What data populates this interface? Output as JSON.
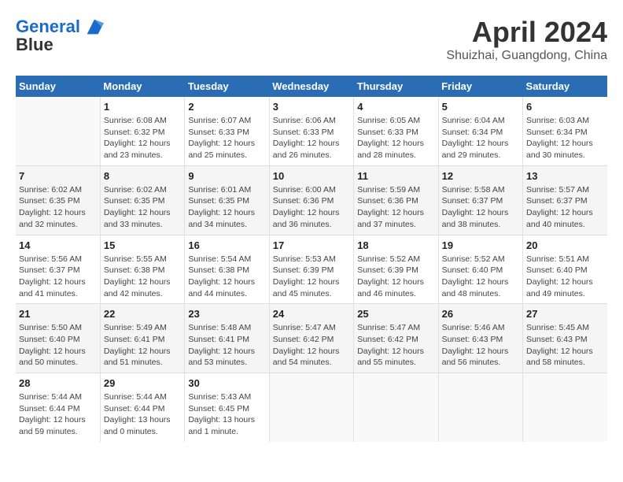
{
  "header": {
    "logo_line1": "General",
    "logo_line2": "Blue",
    "month": "April 2024",
    "location": "Shuizhai, Guangdong, China"
  },
  "weekdays": [
    "Sunday",
    "Monday",
    "Tuesday",
    "Wednesday",
    "Thursday",
    "Friday",
    "Saturday"
  ],
  "weeks": [
    [
      {
        "day": "",
        "info": ""
      },
      {
        "day": "1",
        "info": "Sunrise: 6:08 AM\nSunset: 6:32 PM\nDaylight: 12 hours\nand 23 minutes."
      },
      {
        "day": "2",
        "info": "Sunrise: 6:07 AM\nSunset: 6:33 PM\nDaylight: 12 hours\nand 25 minutes."
      },
      {
        "day": "3",
        "info": "Sunrise: 6:06 AM\nSunset: 6:33 PM\nDaylight: 12 hours\nand 26 minutes."
      },
      {
        "day": "4",
        "info": "Sunrise: 6:05 AM\nSunset: 6:33 PM\nDaylight: 12 hours\nand 28 minutes."
      },
      {
        "day": "5",
        "info": "Sunrise: 6:04 AM\nSunset: 6:34 PM\nDaylight: 12 hours\nand 29 minutes."
      },
      {
        "day": "6",
        "info": "Sunrise: 6:03 AM\nSunset: 6:34 PM\nDaylight: 12 hours\nand 30 minutes."
      }
    ],
    [
      {
        "day": "7",
        "info": "Sunrise: 6:02 AM\nSunset: 6:35 PM\nDaylight: 12 hours\nand 32 minutes."
      },
      {
        "day": "8",
        "info": "Sunrise: 6:02 AM\nSunset: 6:35 PM\nDaylight: 12 hours\nand 33 minutes."
      },
      {
        "day": "9",
        "info": "Sunrise: 6:01 AM\nSunset: 6:35 PM\nDaylight: 12 hours\nand 34 minutes."
      },
      {
        "day": "10",
        "info": "Sunrise: 6:00 AM\nSunset: 6:36 PM\nDaylight: 12 hours\nand 36 minutes."
      },
      {
        "day": "11",
        "info": "Sunrise: 5:59 AM\nSunset: 6:36 PM\nDaylight: 12 hours\nand 37 minutes."
      },
      {
        "day": "12",
        "info": "Sunrise: 5:58 AM\nSunset: 6:37 PM\nDaylight: 12 hours\nand 38 minutes."
      },
      {
        "day": "13",
        "info": "Sunrise: 5:57 AM\nSunset: 6:37 PM\nDaylight: 12 hours\nand 40 minutes."
      }
    ],
    [
      {
        "day": "14",
        "info": "Sunrise: 5:56 AM\nSunset: 6:37 PM\nDaylight: 12 hours\nand 41 minutes."
      },
      {
        "day": "15",
        "info": "Sunrise: 5:55 AM\nSunset: 6:38 PM\nDaylight: 12 hours\nand 42 minutes."
      },
      {
        "day": "16",
        "info": "Sunrise: 5:54 AM\nSunset: 6:38 PM\nDaylight: 12 hours\nand 44 minutes."
      },
      {
        "day": "17",
        "info": "Sunrise: 5:53 AM\nSunset: 6:39 PM\nDaylight: 12 hours\nand 45 minutes."
      },
      {
        "day": "18",
        "info": "Sunrise: 5:52 AM\nSunset: 6:39 PM\nDaylight: 12 hours\nand 46 minutes."
      },
      {
        "day": "19",
        "info": "Sunrise: 5:52 AM\nSunset: 6:40 PM\nDaylight: 12 hours\nand 48 minutes."
      },
      {
        "day": "20",
        "info": "Sunrise: 5:51 AM\nSunset: 6:40 PM\nDaylight: 12 hours\nand 49 minutes."
      }
    ],
    [
      {
        "day": "21",
        "info": "Sunrise: 5:50 AM\nSunset: 6:40 PM\nDaylight: 12 hours\nand 50 minutes."
      },
      {
        "day": "22",
        "info": "Sunrise: 5:49 AM\nSunset: 6:41 PM\nDaylight: 12 hours\nand 51 minutes."
      },
      {
        "day": "23",
        "info": "Sunrise: 5:48 AM\nSunset: 6:41 PM\nDaylight: 12 hours\nand 53 minutes."
      },
      {
        "day": "24",
        "info": "Sunrise: 5:47 AM\nSunset: 6:42 PM\nDaylight: 12 hours\nand 54 minutes."
      },
      {
        "day": "25",
        "info": "Sunrise: 5:47 AM\nSunset: 6:42 PM\nDaylight: 12 hours\nand 55 minutes."
      },
      {
        "day": "26",
        "info": "Sunrise: 5:46 AM\nSunset: 6:43 PM\nDaylight: 12 hours\nand 56 minutes."
      },
      {
        "day": "27",
        "info": "Sunrise: 5:45 AM\nSunset: 6:43 PM\nDaylight: 12 hours\nand 58 minutes."
      }
    ],
    [
      {
        "day": "28",
        "info": "Sunrise: 5:44 AM\nSunset: 6:44 PM\nDaylight: 12 hours\nand 59 minutes."
      },
      {
        "day": "29",
        "info": "Sunrise: 5:44 AM\nSunset: 6:44 PM\nDaylight: 13 hours\nand 0 minutes."
      },
      {
        "day": "30",
        "info": "Sunrise: 5:43 AM\nSunset: 6:45 PM\nDaylight: 13 hours\nand 1 minute."
      },
      {
        "day": "",
        "info": ""
      },
      {
        "day": "",
        "info": ""
      },
      {
        "day": "",
        "info": ""
      },
      {
        "day": "",
        "info": ""
      }
    ]
  ]
}
